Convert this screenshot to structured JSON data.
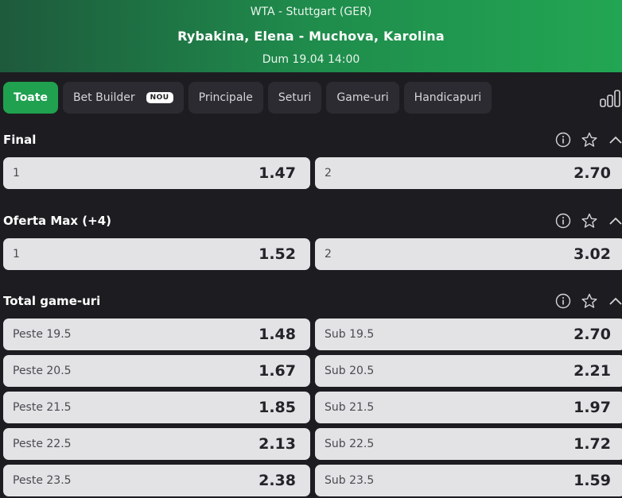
{
  "header": {
    "league": "WTA - Stuttgart (GER)",
    "match": "Rybakina, Elena - Muchova, Karolina",
    "date": "Dum 19.04 14:00"
  },
  "tabs": [
    {
      "label": "Toate",
      "active": true
    },
    {
      "label": "Bet Builder",
      "badge": "NOU"
    },
    {
      "label": "Principale"
    },
    {
      "label": "Seturi"
    },
    {
      "label": "Game-uri"
    },
    {
      "label": "Handicapuri"
    }
  ],
  "icons": [
    "stats-icon",
    "info-icon",
    "star-icon",
    "chevron-up-icon"
  ],
  "colors": {
    "accent": "#1fa14f",
    "background": "#1d1d21",
    "tab": "#2b2b31",
    "odd_button": "#e3e3e6"
  },
  "markets": [
    {
      "title": "Final",
      "rows": [
        [
          {
            "label": "1",
            "odd": "1.47"
          },
          {
            "label": "2",
            "odd": "2.70"
          }
        ]
      ]
    },
    {
      "title": "Oferta Max (+4)",
      "rows": [
        [
          {
            "label": "1",
            "odd": "1.52"
          },
          {
            "label": "2",
            "odd": "3.02"
          }
        ]
      ]
    },
    {
      "title": "Total game-uri",
      "rows": [
        [
          {
            "label": "Peste 19.5",
            "odd": "1.48"
          },
          {
            "label": "Sub 19.5",
            "odd": "2.70"
          }
        ],
        [
          {
            "label": "Peste 20.5",
            "odd": "1.67"
          },
          {
            "label": "Sub 20.5",
            "odd": "2.21"
          }
        ],
        [
          {
            "label": "Peste 21.5",
            "odd": "1.85"
          },
          {
            "label": "Sub 21.5",
            "odd": "1.97"
          }
        ],
        [
          {
            "label": "Peste 22.5",
            "odd": "2.13"
          },
          {
            "label": "Sub 22.5",
            "odd": "1.72"
          }
        ],
        [
          {
            "label": "Peste 23.5",
            "odd": "2.38"
          },
          {
            "label": "Sub 23.5",
            "odd": "1.59"
          }
        ]
      ]
    }
  ]
}
